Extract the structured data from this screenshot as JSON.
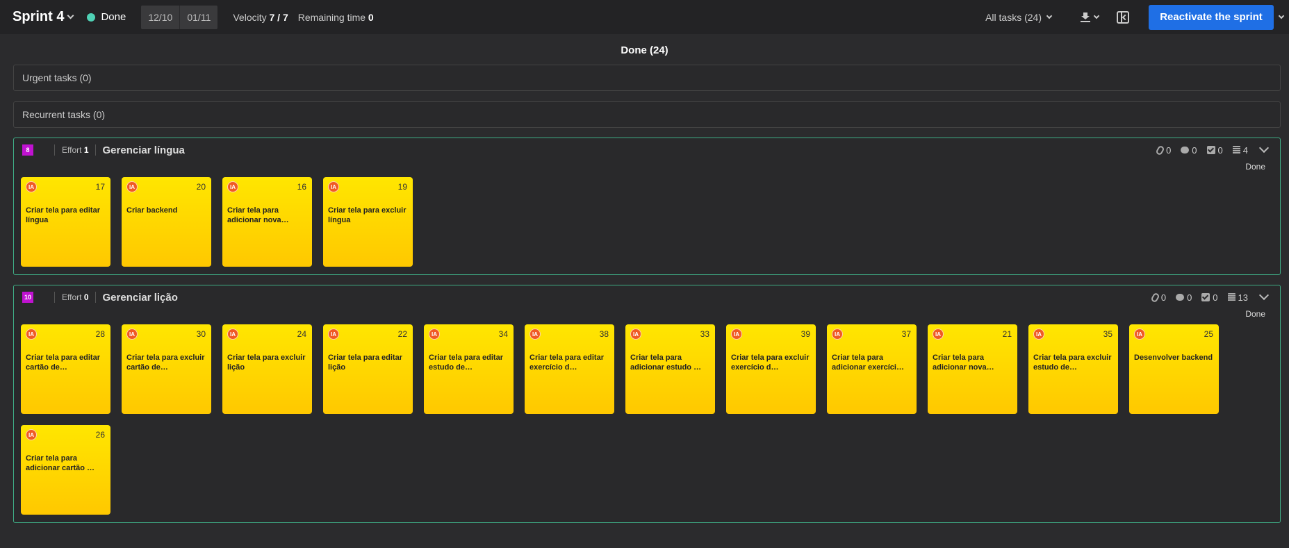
{
  "topbar": {
    "sprint_title": "Sprint 4",
    "status": "Done",
    "date_start": "12/10",
    "date_end": "01/11",
    "velocity_label": "Velocity",
    "velocity_value": "7 / 7",
    "remaining_label": "Remaining time",
    "remaining_value": "0",
    "all_tasks": "All tasks (24)",
    "reactivate": "Reactivate the sprint"
  },
  "column": {
    "title": "Done (24)"
  },
  "urgent": "Urgent tasks (0)",
  "recurrent": "Recurrent tasks (0)",
  "stories": [
    {
      "badge": "8",
      "effort_label": "Effort",
      "effort": "1",
      "title": "Gerenciar língua",
      "attachments": "0",
      "comments": "0",
      "checks": "0",
      "tasks": "4",
      "status": "Done",
      "cards": [
        {
          "avatar": "IA",
          "num": "17",
          "title": "Criar tela para editar língua"
        },
        {
          "avatar": "IA",
          "num": "20",
          "title": "Criar backend"
        },
        {
          "avatar": "IA",
          "num": "16",
          "title": "Criar tela para adicionar nova…"
        },
        {
          "avatar": "IA",
          "num": "19",
          "title": "Criar tela para excluir língua"
        }
      ]
    },
    {
      "badge": "10",
      "effort_label": "Effort",
      "effort": "0",
      "title": "Gerenciar lição",
      "attachments": "0",
      "comments": "0",
      "checks": "0",
      "tasks": "13",
      "status": "Done",
      "cards": [
        {
          "avatar": "IA",
          "num": "28",
          "title": "Criar tela para editar cartão de…"
        },
        {
          "avatar": "IA",
          "num": "30",
          "title": "Criar tela para excluir cartão de…"
        },
        {
          "avatar": "IA",
          "num": "24",
          "title": "Criar tela para excluir lição"
        },
        {
          "avatar": "IA",
          "num": "22",
          "title": "Criar tela para editar lição"
        },
        {
          "avatar": "IA",
          "num": "34",
          "title": "Criar tela para editar estudo de…"
        },
        {
          "avatar": "IA",
          "num": "38",
          "title": "Criar tela para editar exercício d…"
        },
        {
          "avatar": "IA",
          "num": "33",
          "title": "Criar tela para adicionar estudo …"
        },
        {
          "avatar": "IA",
          "num": "39",
          "title": "Criar tela para excluir exercício d…"
        },
        {
          "avatar": "IA",
          "num": "37",
          "title": "Criar tela para adicionar exercíci…"
        },
        {
          "avatar": "IA",
          "num": "21",
          "title": "Criar tela para adicionar nova…"
        },
        {
          "avatar": "IA",
          "num": "35",
          "title": "Criar tela para excluir estudo de…"
        },
        {
          "avatar": "IA",
          "num": "25",
          "title": "Desenvolver backend"
        },
        {
          "avatar": "IA",
          "num": "26",
          "title": "Criar tela para adicionar cartão …"
        }
      ]
    }
  ]
}
